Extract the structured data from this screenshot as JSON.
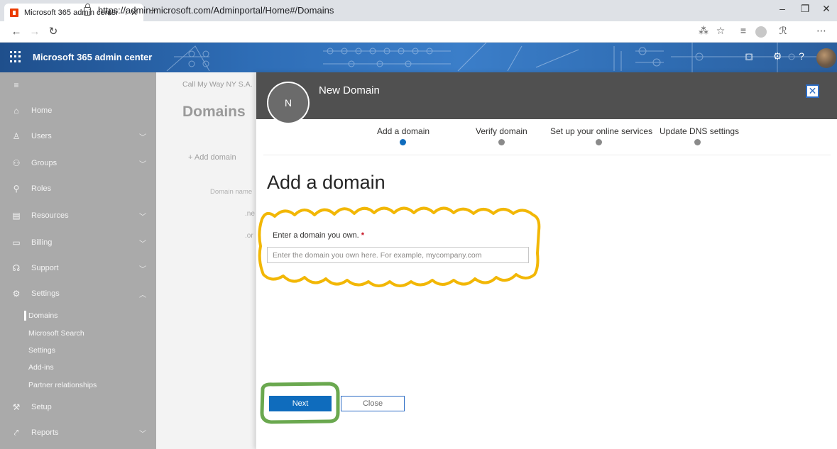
{
  "browser": {
    "tab_title": "Microsoft 365 admin center - Do",
    "tab_close": "✕",
    "new_tab": "+",
    "url": "https://admin.microsoft.com/Adminportal/Home#/Domains",
    "window_controls": {
      "minimize": "–",
      "restore": "❐",
      "close": "✕"
    }
  },
  "header": {
    "app_name": "Microsoft 365 admin center",
    "question": "?"
  },
  "sidebar": {
    "items": [
      {
        "label": "Home",
        "icon": "home-icon"
      },
      {
        "label": "Users",
        "icon": "user-icon"
      },
      {
        "label": "Groups",
        "icon": "groups-icon"
      },
      {
        "label": "Roles",
        "icon": "roles-icon"
      },
      {
        "label": "Resources",
        "icon": "resources-icon"
      },
      {
        "label": "Billing",
        "icon": "billing-icon"
      },
      {
        "label": "Support",
        "icon": "support-icon"
      },
      {
        "label": "Settings",
        "icon": "gear-icon"
      },
      {
        "label": "Setup",
        "icon": "setup-icon"
      },
      {
        "label": "Reports",
        "icon": "reports-icon"
      }
    ],
    "settings_subitems": [
      {
        "label": "Domains"
      },
      {
        "label": "Microsoft Search"
      },
      {
        "label": "Settings"
      },
      {
        "label": "Add-ins"
      },
      {
        "label": "Partner relationships"
      }
    ]
  },
  "background_page": {
    "breadcrumb": "Call My Way NY S.A.",
    "title": "Domains",
    "add_domain": "+ Add domain",
    "column_header": "Domain name",
    "rows": [
      ".ne",
      ".or"
    ]
  },
  "panel": {
    "avatar_initial": "N",
    "title": "New Domain",
    "close_glyph": "✕",
    "steps": [
      {
        "label": "Add a domain",
        "active": true
      },
      {
        "label": "Verify domain",
        "active": false
      },
      {
        "label": "Set up your online services",
        "active": false
      },
      {
        "label": "Update DNS settings",
        "active": false
      }
    ],
    "heading": "Add a domain",
    "field_label": "Enter a domain you own.",
    "required_mark": "*",
    "input_value": "",
    "input_placeholder": "Enter the domain you own here. For example, mycompany.com",
    "next_label": "Next",
    "close_label": "Close"
  },
  "colors": {
    "accent": "#0f6cbd",
    "annotation_yellow": "#f2b705",
    "annotation_green": "#6aa84f",
    "sidebar_bg": "#aaaaaa",
    "panel_header_bg": "#505050"
  }
}
